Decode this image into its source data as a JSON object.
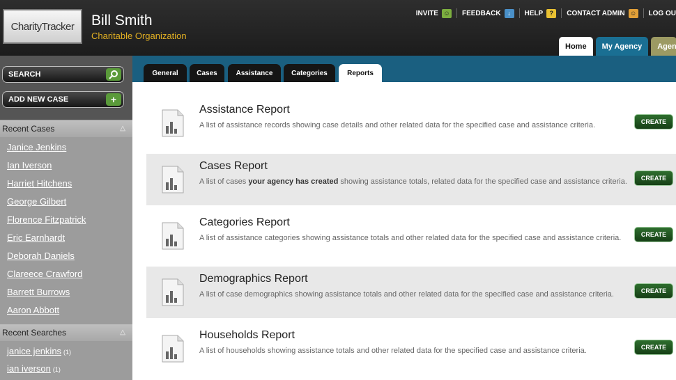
{
  "header": {
    "logo_text": "CharityTracker",
    "user_name": "Bill Smith",
    "org_name": "Charitable Organization",
    "top_nav": [
      {
        "label": "INVITE",
        "icon": "user-add-icon"
      },
      {
        "label": "FEEDBACK",
        "icon": "feedback-icon"
      },
      {
        "label": "HELP",
        "icon": "help-icon"
      },
      {
        "label": "CONTACT ADMIN",
        "icon": "contact-admin-icon"
      },
      {
        "label": "LOG OU"
      }
    ],
    "main_tabs": [
      "Home",
      "My Agency",
      "Agen"
    ]
  },
  "sidebar": {
    "search_label": "SEARCH",
    "add_case_label": "ADD NEW CASE",
    "recent_cases_title": "Recent Cases",
    "recent_cases": [
      "Janice Jenkins",
      "Ian Iverson",
      "Harriet Hitchens",
      "George Gilbert",
      "Florence Fitzpatrick",
      "Eric Earnhardt",
      "Deborah Daniels",
      "Clareece Crawford",
      "Barrett Burrows",
      "Aaron Abbott"
    ],
    "recent_searches_title": "Recent Searches",
    "recent_searches": [
      {
        "term": "janice jenkins",
        "count": "(1)"
      },
      {
        "term": "ian iverson",
        "count": "(1)"
      }
    ]
  },
  "subtabs": [
    "General",
    "Cases",
    "Assistance",
    "Categories",
    "Reports"
  ],
  "active_subtab": "Reports",
  "reports": [
    {
      "title": "Assistance Report",
      "desc_pre": "A list of assistance records showing case details and other related data for the specified case and assistance criteria.",
      "desc_bold": "",
      "desc_post": "",
      "button": "CREATE"
    },
    {
      "title": "Cases Report",
      "desc_pre": "A list of cases ",
      "desc_bold": "your agency has created",
      "desc_post": " showing assistance totals, related data for the specified case and assistance criteria.",
      "button": "CREATE"
    },
    {
      "title": "Categories Report",
      "desc_pre": "A list of assistance categories showing assistance totals and other related data for the specified case and assistance criteria.",
      "desc_bold": "",
      "desc_post": "",
      "button": "CREATE"
    },
    {
      "title": "Demographics Report",
      "desc_pre": "A list of case demographics showing assistance totals and other related data for the specified case and assistance criteria.",
      "desc_bold": "",
      "desc_post": "",
      "button": "CREATE"
    },
    {
      "title": "Households Report",
      "desc_pre": "A list of households showing assistance totals and other related data for the specified case and assistance criteria.",
      "desc_bold": "",
      "desc_post": "",
      "button": "CREATE"
    }
  ],
  "colors": {
    "accent_gold": "#e2b023",
    "tab_blue": "#1a6f93",
    "button_green": "#2e6e2e"
  }
}
